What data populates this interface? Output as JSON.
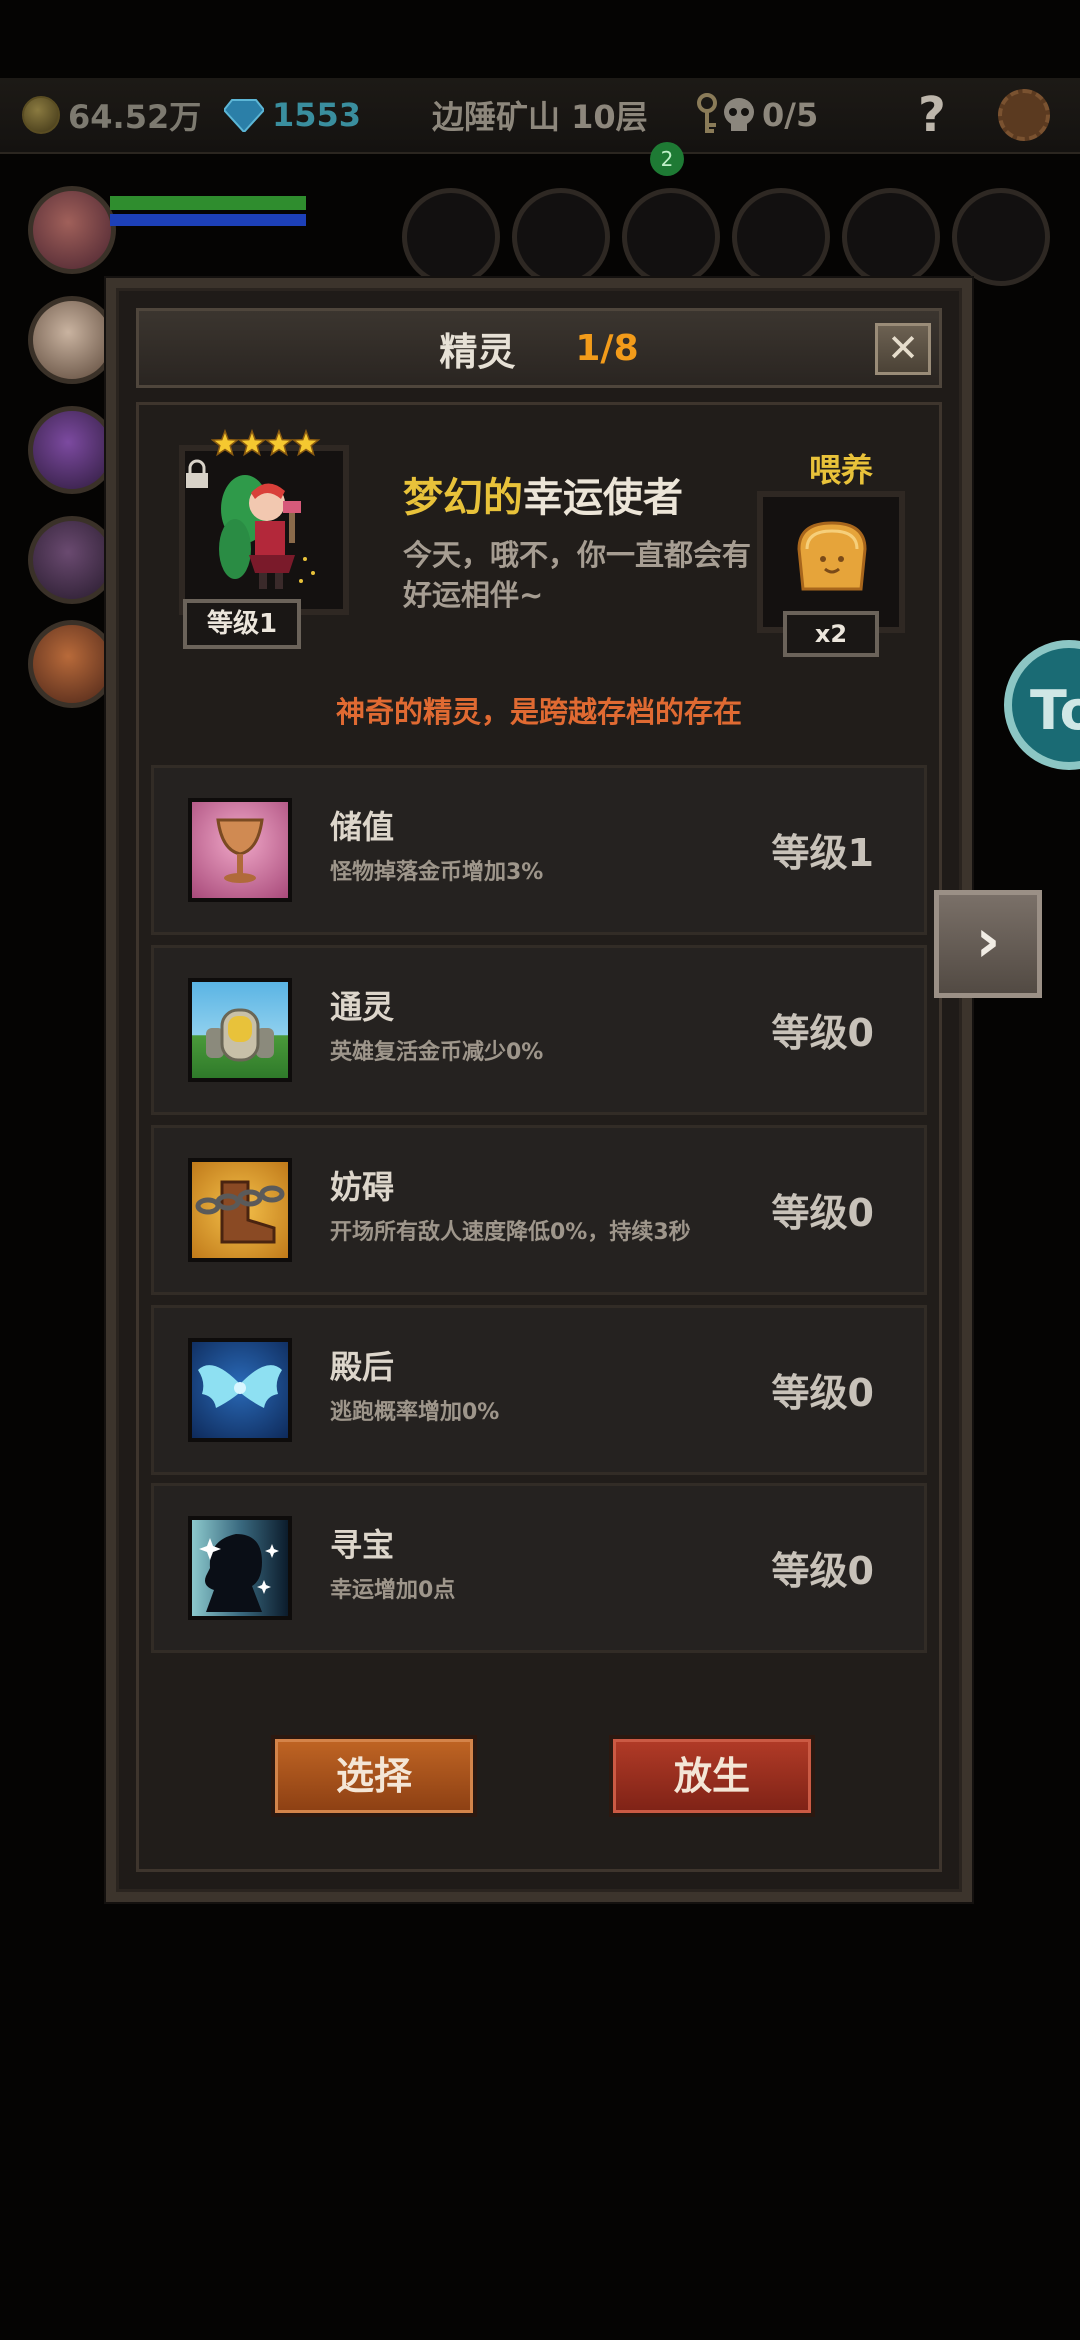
{
  "hud": {
    "gold": "64.52万",
    "gems": "1553",
    "location": "边陲矿山 10层",
    "skull_count": "0/5",
    "help": "?",
    "notification_badge": "2"
  },
  "side_button": {
    "label": "To"
  },
  "dialog": {
    "title": "精灵",
    "page": "1/8",
    "close": "✕",
    "sprite": {
      "name_adj": "梦幻的",
      "name_noun": "幸运使者",
      "description": "今天，哦不，你一直都会有好运相伴~",
      "level": "等级1",
      "stars": 4
    },
    "feed": {
      "label": "喂养",
      "count": "x2"
    },
    "tagline": "神奇的精灵，是跨越存档的存在",
    "skills": [
      {
        "name": "储值",
        "desc": "怪物掉落金币增加3%",
        "level": "等级1",
        "icon": "goblet-icon"
      },
      {
        "name": "通灵",
        "desc": "英雄复活金币减少0%",
        "level": "等级0",
        "icon": "tombstone-icon"
      },
      {
        "name": "妨碍",
        "desc": "开场所有敌人速度降低0%，持续3秒",
        "level": "等级0",
        "icon": "chained-boot-icon"
      },
      {
        "name": "殿后",
        "desc": "逃跑概率增加0%",
        "level": "等级0",
        "icon": "wings-icon"
      },
      {
        "name": "寻宝",
        "desc": "幸运增加0点",
        "level": "等级0",
        "icon": "silhouette-sparkle-icon"
      }
    ],
    "buttons": {
      "select": "选择",
      "release": "放生"
    }
  },
  "next_arrow": "›",
  "colors": {
    "gold_text": "#e8c23a",
    "page_number": "#f29b1a",
    "tagline": "#e06a32",
    "select_button": "#b05a1e",
    "release_button": "#a03220"
  }
}
